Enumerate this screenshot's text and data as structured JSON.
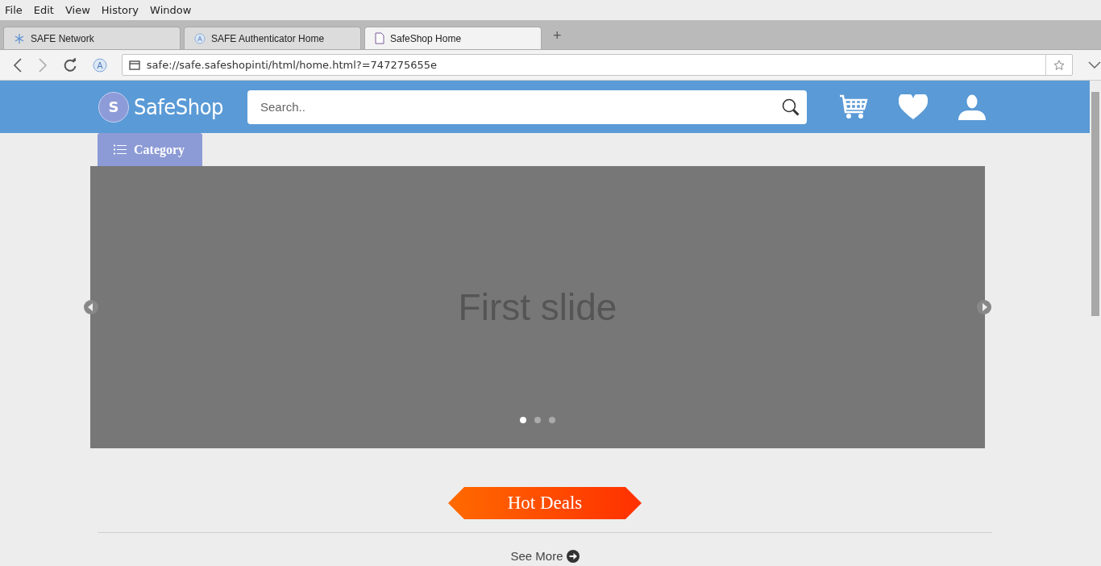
{
  "menu": [
    "File",
    "Edit",
    "View",
    "History",
    "Window"
  ],
  "tabs": [
    {
      "label": "SAFE Network",
      "selected": false,
      "kind": "network"
    },
    {
      "label": "SAFE Authenticator Home",
      "selected": false,
      "kind": "auth"
    },
    {
      "label": "SafeShop Home",
      "selected": true,
      "kind": "page"
    }
  ],
  "new_tab": "+",
  "address": {
    "value": "safe://safe.safeshopinti/html/home.html?=747275655e"
  },
  "header": {
    "logo_letter": "S",
    "logo_text": "SafeShop",
    "search": {
      "placeholder": "Search.."
    }
  },
  "category": "Category",
  "carousel": {
    "caption": "First slide",
    "dots": [
      {
        "selected": true
      },
      {
        "selected": false
      },
      {
        "selected": false
      }
    ]
  },
  "section_title": "Hot Deals",
  "see_more": "See More"
}
